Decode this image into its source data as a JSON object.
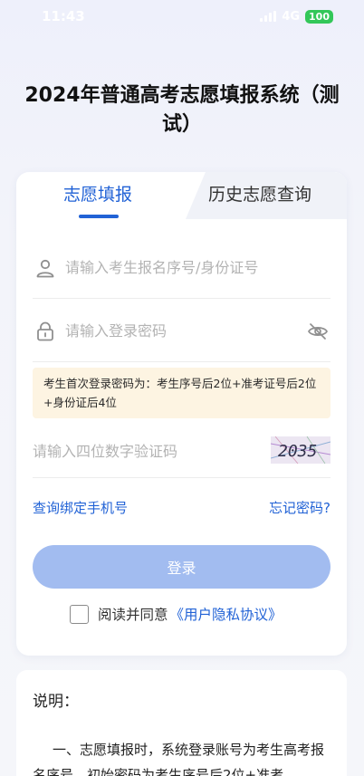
{
  "status_bar": {
    "time": "11:43",
    "network": "4G",
    "battery": "100"
  },
  "page": {
    "title": "2024年普通高考志愿填报系统（测试）"
  },
  "tabs": [
    {
      "label": "志愿填报",
      "active": true
    },
    {
      "label": "历史志愿查询",
      "active": false
    }
  ],
  "form": {
    "username_placeholder": "请输入考生报名序号/身份证号",
    "password_placeholder": "请输入登录密码",
    "notice": "考生首次登录密码为：考生序号后2位+准考证号后2位+身份证后4位",
    "captcha_placeholder": "请输入四位数字验证码",
    "captcha_text": "2035",
    "bind_phone_link": "查询绑定手机号",
    "forgot_password_link": "忘记密码?",
    "login_label": "登录",
    "agree_text": "阅读并同意",
    "agree_link": "《用户隐私协议》"
  },
  "info": {
    "title": "说明：",
    "body": "一、志愿填报时，系统登录账号为考生高考报名序号，初始密码为考生序号后2位+准考"
  },
  "colors": {
    "primary": "#2162d6",
    "button_disabled": "#a2bcf0",
    "notice_bg": "#fdf4e2",
    "battery": "#33c759"
  }
}
